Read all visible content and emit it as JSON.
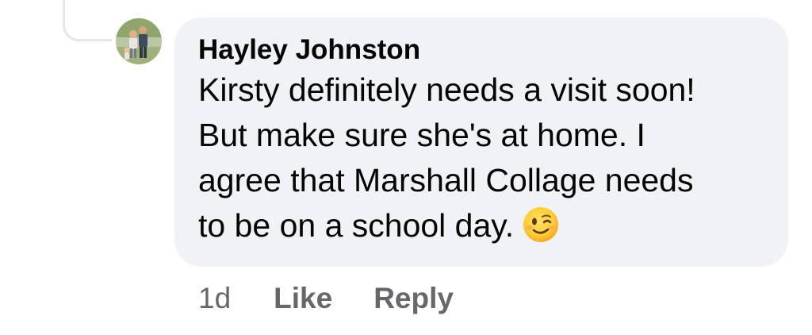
{
  "comment": {
    "author": "Hayley Johnston",
    "lines": [
      "Kirsty definitely needs a visit soon!",
      "But make sure she's at home. I",
      "agree that Marshall Collage needs",
      "to be on a school day."
    ],
    "emoji": "winking-face-emoji"
  },
  "actions": {
    "timestamp": "1d",
    "like_label": "Like",
    "reply_label": "Reply"
  },
  "colors": {
    "bubble_bg": "#f0f2f5",
    "text": "#050505",
    "secondary_text": "#65676b",
    "thread_line": "#e4e6eb"
  }
}
